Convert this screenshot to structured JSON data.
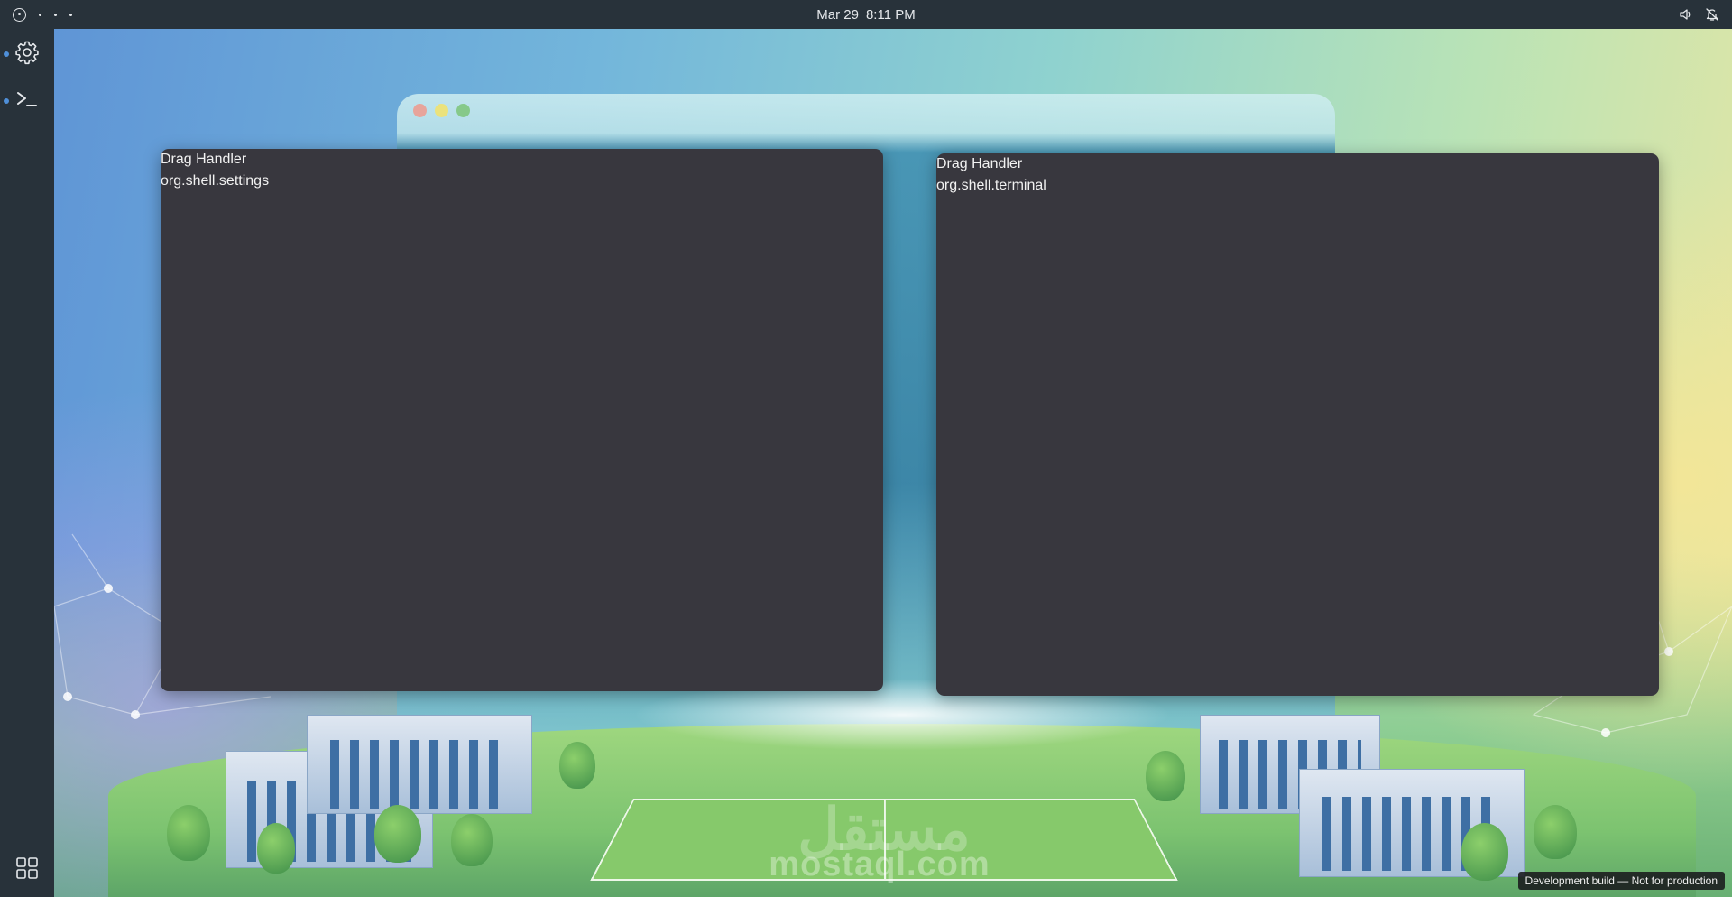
{
  "topbar": {
    "date": "Mar 29",
    "time": "8:11 PM",
    "icons": [
      "activities-icon",
      "volume-icon",
      "notifications-off-icon"
    ]
  },
  "dock": {
    "items": [
      {
        "name": "settings",
        "icon": "gear-icon",
        "running": true
      },
      {
        "name": "terminal",
        "icon": "terminal-icon",
        "running": true
      }
    ],
    "app_grid_icon": "app-grid-icon"
  },
  "windows": [
    {
      "drag_label": "Drag Handler",
      "app_id": "org.shell.settings"
    },
    {
      "drag_label": "Drag Handler",
      "app_id": "org.shell.terminal"
    }
  ],
  "wallpaper": {
    "watermark": "mostaql.com",
    "watermark_ar": "مستقل"
  },
  "dev_badge": "Development build — Not for production",
  "colors": {
    "panel_bg": "#28323a",
    "window_bg": "#38373e",
    "running_indicator": "#4f8fd8"
  }
}
